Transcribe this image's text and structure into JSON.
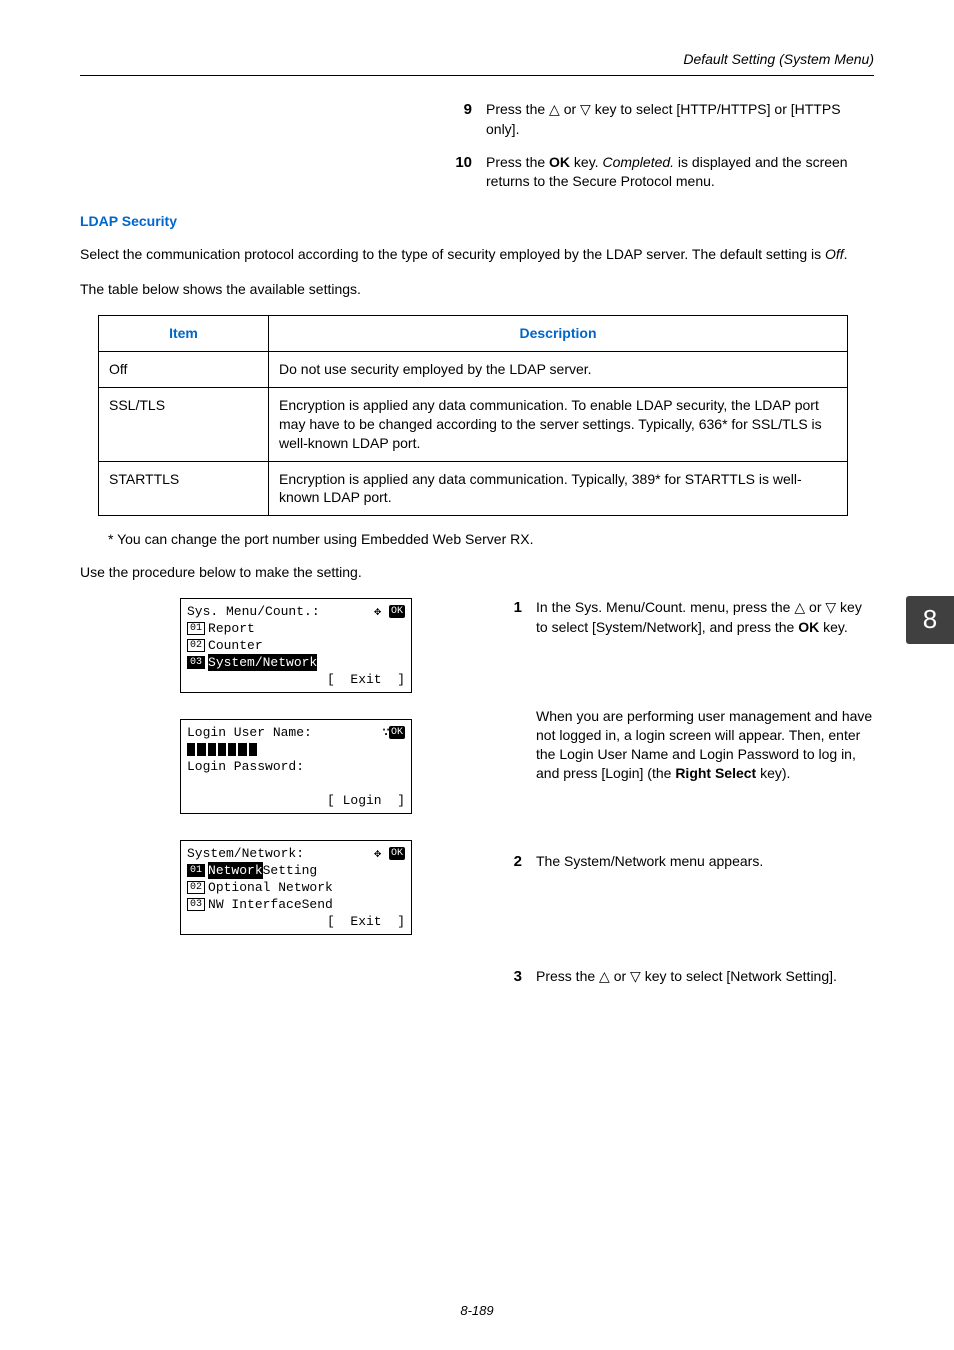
{
  "header": "Default Setting (System Menu)",
  "top_steps": [
    {
      "num": "9",
      "html_parts": [
        "Press the ",
        "△",
        " or ",
        "▽",
        " key to select [HTTP/HTTPS] or [HTTPS only]."
      ]
    },
    {
      "num": "10",
      "html_parts": [
        "Press the ",
        "OK",
        " key. ",
        "Completed.",
        " is displayed and the screen returns to the Secure Protocol menu."
      ],
      "bold_idx": [
        1
      ],
      "italic_idx": [
        3
      ]
    }
  ],
  "section_heading": "LDAP Security",
  "p1": "Select the communication protocol according to the type of security employed by the LDAP server. The default setting is ",
  "p1_it": "Off",
  "p1_tail": ".",
  "p2": "The table below shows the available settings.",
  "table": {
    "headers": [
      "Item",
      "Description"
    ],
    "rows": [
      {
        "item": "Off",
        "desc": "Do not use security employed by the LDAP server."
      },
      {
        "item": "SSL/TLS",
        "desc": "Encryption is applied any data communication. To enable LDAP security, the LDAP port may have to be changed according to the server settings. Typically, 636* for SSL/TLS is well-known LDAP port."
      },
      {
        "item": "STARTTLS",
        "desc": "Encryption is applied any data communication. Typically, 389* for STARTTLS is well-known LDAP port."
      }
    ]
  },
  "footnote": "* You can change the port number using Embedded Web Server RX.",
  "p3": "Use the procedure below to make the setting.",
  "side_tab": "8",
  "lcd": [
    {
      "title": "Sys. Menu/Count.:",
      "title_glyph": "✥",
      "rows": [
        {
          "num": "01",
          "text": "Report"
        },
        {
          "num": "02",
          "text": "Counter"
        },
        {
          "num": "03",
          "text": "System/Network",
          "hl": true
        }
      ],
      "footer": "[  Exit  ]"
    },
    {
      "login": true,
      "title": "Login User Name:",
      "pass": "Login Password:",
      "footer": "[ Login  ]"
    },
    {
      "title": "System/Network:",
      "title_glyph": "✥",
      "rows": [
        {
          "num": "01",
          "text": "Network Setting",
          "hl": true,
          "hl_split": "Network"
        },
        {
          "num": "02",
          "text": "Optional Network"
        },
        {
          "num": "03",
          "text": "NW InterfaceSend"
        }
      ],
      "footer": "[  Exit  ]"
    }
  ],
  "right_steps": [
    {
      "num": "1",
      "parts": [
        "In the Sys. Menu/Count. menu, press the ",
        "△",
        " or ",
        "▽",
        " key to select [System/Network], and press the ",
        "OK",
        " key."
      ],
      "bold_idx": [
        5
      ]
    },
    {
      "num": "",
      "parts": [
        "When you are performing user management and have not logged in, a login screen will appear. Then, enter the Login User Name and Login Password to log in, and press [Login] (the ",
        "Right Select",
        " key)."
      ],
      "bold_idx": [
        1
      ]
    },
    {
      "num": "2",
      "parts": [
        "The System/Network menu appears."
      ]
    },
    {
      "num": "3",
      "parts": [
        "Press the ",
        "△",
        " or ",
        "▽",
        " key to select [Network Setting]."
      ]
    }
  ],
  "page_num": "8-189"
}
